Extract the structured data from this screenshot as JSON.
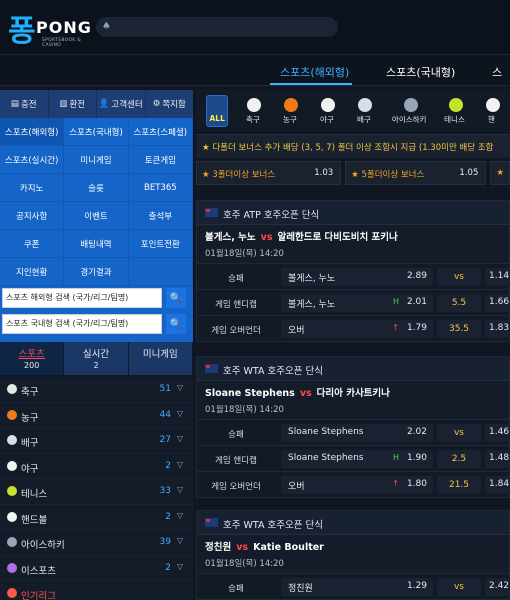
{
  "header": {
    "logo_main": "퐁",
    "logo_sub": "PONG",
    "logo_tag": "SPORTSBOOK & CASINO"
  },
  "topnav": {
    "tabs": [
      "스포츠(해외형)",
      "스포츠(국내형)",
      "스"
    ]
  },
  "quick": [
    "충전",
    "환전",
    "고객센터",
    "쪽지함"
  ],
  "menu": [
    "스포츠(해외형)",
    "스포츠(국내형)",
    "스포츠(스페셜)",
    "스포츠(실시간)",
    "미니게임",
    "토큰게임",
    "카지노",
    "슬롯",
    "BET365",
    "공지사항",
    "이벤트",
    "출석부",
    "쿠폰",
    "배팅내역",
    "포인트전환",
    "지인현황",
    "경기결과",
    ""
  ],
  "search": {
    "overseas_placeholder": "스포츠 해외형 검색 (국가/리그/팀명)",
    "domestic_placeholder": "스포츠 국내형 검색 (국가/리그/팀명)"
  },
  "sport_tabs": [
    {
      "title": "스포츠",
      "count": "200"
    },
    {
      "title": "실시간",
      "count": "2"
    },
    {
      "title": "미니게임",
      "count": ""
    }
  ],
  "sports": [
    {
      "name": "축구",
      "count": "51",
      "color": "#e8e8e8"
    },
    {
      "name": "농구",
      "count": "44",
      "color": "#f07a1a"
    },
    {
      "name": "배구",
      "count": "27",
      "color": "#d8dde6"
    },
    {
      "name": "야구",
      "count": "2",
      "color": "#f2f2f2"
    },
    {
      "name": "테니스",
      "count": "33",
      "color": "#c6e12b"
    },
    {
      "name": "핸드볼",
      "count": "2",
      "color": "#f2f2f2"
    },
    {
      "name": "아이스하키",
      "count": "39",
      "color": "#9aa6b6"
    },
    {
      "name": "이스포츠",
      "count": "2",
      "color": "#b070e0"
    },
    {
      "name": "인기리그",
      "count": "",
      "color": "#ff5a4a"
    }
  ],
  "sport_icons": [
    {
      "label": "축구",
      "color": "#f2f2f2"
    },
    {
      "label": "농구",
      "color": "#f07a1a"
    },
    {
      "label": "야구",
      "color": "#f2f2f2"
    },
    {
      "label": "배구",
      "color": "#d8dde6"
    },
    {
      "label": "아이스하키",
      "color": "#9aa6b6"
    },
    {
      "label": "테니스",
      "color": "#c6e12b"
    },
    {
      "label": "핸",
      "color": "#f2f2f2"
    }
  ],
  "all_label": "ALL",
  "bonus": {
    "banner": "★ 다폴더 보너스 추가 배당 (3, 5, 7) 폴더 이상 조합시 지급 (1.30미만 배당 조합",
    "items": [
      {
        "label": "★ 3폴더이상 보너스",
        "odds": "1.03"
      },
      {
        "label": "★ 5폴더이상 보너스",
        "odds": "1.05"
      },
      {
        "label": "★",
        "odds": ""
      }
    ]
  },
  "matches": [
    {
      "league": "호주 ATP 호주오픈 단식",
      "home": "볼게스, 누노",
      "vs": "vs",
      "away": "알레한드로 다비도비치 포키나",
      "time": "01월18일(목) 14:20",
      "rows": [
        {
          "label": "승패",
          "name": "볼게스, 누노",
          "odds": "2.89",
          "arrow": "",
          "mid": "vs",
          "away": "1.14"
        },
        {
          "label": "게임 핸디캡",
          "name": "볼게스, 누노",
          "odds": "2.01",
          "arrow": "H",
          "mid": "5.5",
          "away": "1.66"
        },
        {
          "label": "게임 오버언더",
          "name": "오버",
          "odds": "1.79",
          "arrow": "↑",
          "mid": "35.5",
          "away": "1.83"
        }
      ]
    },
    {
      "league": "호주 WTA 호주오픈 단식",
      "home": "Sloane Stephens",
      "vs": "vs",
      "away": "다리아 카사트키나",
      "time": "01월18일(목) 14:20",
      "rows": [
        {
          "label": "승패",
          "name": "Sloane Stephens",
          "odds": "2.02",
          "arrow": "",
          "mid": "vs",
          "away": "1.46"
        },
        {
          "label": "게임 핸디캡",
          "name": "Sloane Stephens",
          "odds": "1.90",
          "arrow": "H",
          "mid": "2.5",
          "away": "1.48"
        },
        {
          "label": "게임 오버언더",
          "name": "오버",
          "odds": "1.80",
          "arrow": "↑",
          "mid": "21.5",
          "away": "1.84"
        }
      ]
    },
    {
      "league": "호주 WTA 호주오픈 단식",
      "home": "정친원",
      "vs": "vs",
      "away": "Katie Boulter",
      "time": "01월18일(목) 14:20",
      "rows": [
        {
          "label": "승패",
          "name": "정친원",
          "odds": "1.29",
          "arrow": "",
          "mid": "vs",
          "away": "2.42"
        }
      ]
    }
  ]
}
